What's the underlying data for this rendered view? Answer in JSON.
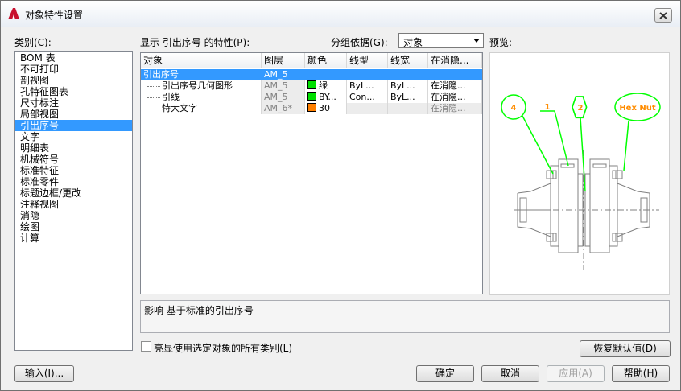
{
  "window": {
    "title": "对象特性设置"
  },
  "category": {
    "label": "类别(C):",
    "items": [
      "BOM 表",
      "不可打印",
      "剖视图",
      "孔特征图表",
      "尺寸标注",
      "局部视图",
      "引出序号",
      "文字",
      "明细表",
      "机械符号",
      "标准特征",
      "标准零件",
      "标题边框/更改",
      "注释视图",
      "消隐",
      "绘图",
      "计算"
    ],
    "selected_index": 6
  },
  "properties_label": "显示 引出序号 的特性(P):",
  "group_by": {
    "label": "分组依据(G):",
    "value": "对象"
  },
  "preview_label": "预览:",
  "grid": {
    "columns": [
      "对象",
      "图层",
      "颜色",
      "线型",
      "线宽",
      "在消隐..."
    ],
    "rows": [
      {
        "object": "引出序号",
        "layer": "AM_5",
        "color": "",
        "swatch": "",
        "linetype": "",
        "lineweight": "",
        "hidden": "",
        "selected": true,
        "level": 0
      },
      {
        "object": "引出序号几何图形",
        "layer": "AM_5",
        "color": "绿",
        "swatch": "#00e000",
        "linetype": "ByL...",
        "lineweight": "ByL...",
        "hidden": "在消隐...",
        "selected": false,
        "level": 1
      },
      {
        "object": "引线",
        "layer": "AM_5",
        "color": "BY...",
        "swatch": "#00e000",
        "linetype": "Con...",
        "lineweight": "ByL...",
        "hidden": "在消隐...",
        "selected": false,
        "level": 1
      },
      {
        "object": "特大文字",
        "layer": "AM_6*",
        "color": "30",
        "swatch": "#ff7f00",
        "linetype": "",
        "lineweight": "",
        "hidden": "在消隐...",
        "selected": false,
        "level": 1
      }
    ]
  },
  "preview": {
    "balloons": [
      "4",
      "1",
      "2",
      "Hex Nut"
    ],
    "balloon_color": "#00ff00",
    "text_color": "#ff8c00"
  },
  "description": "影响 基于标准的引出序号",
  "highlight_checkbox": {
    "label": "亮显使用选定对象的所有类别(L)",
    "checked": false
  },
  "buttons": {
    "restore": "恢复默认值(D)",
    "import": "输入(I)...",
    "ok": "确定",
    "cancel": "取消",
    "apply": "应用(A)",
    "help": "帮助(H)"
  }
}
